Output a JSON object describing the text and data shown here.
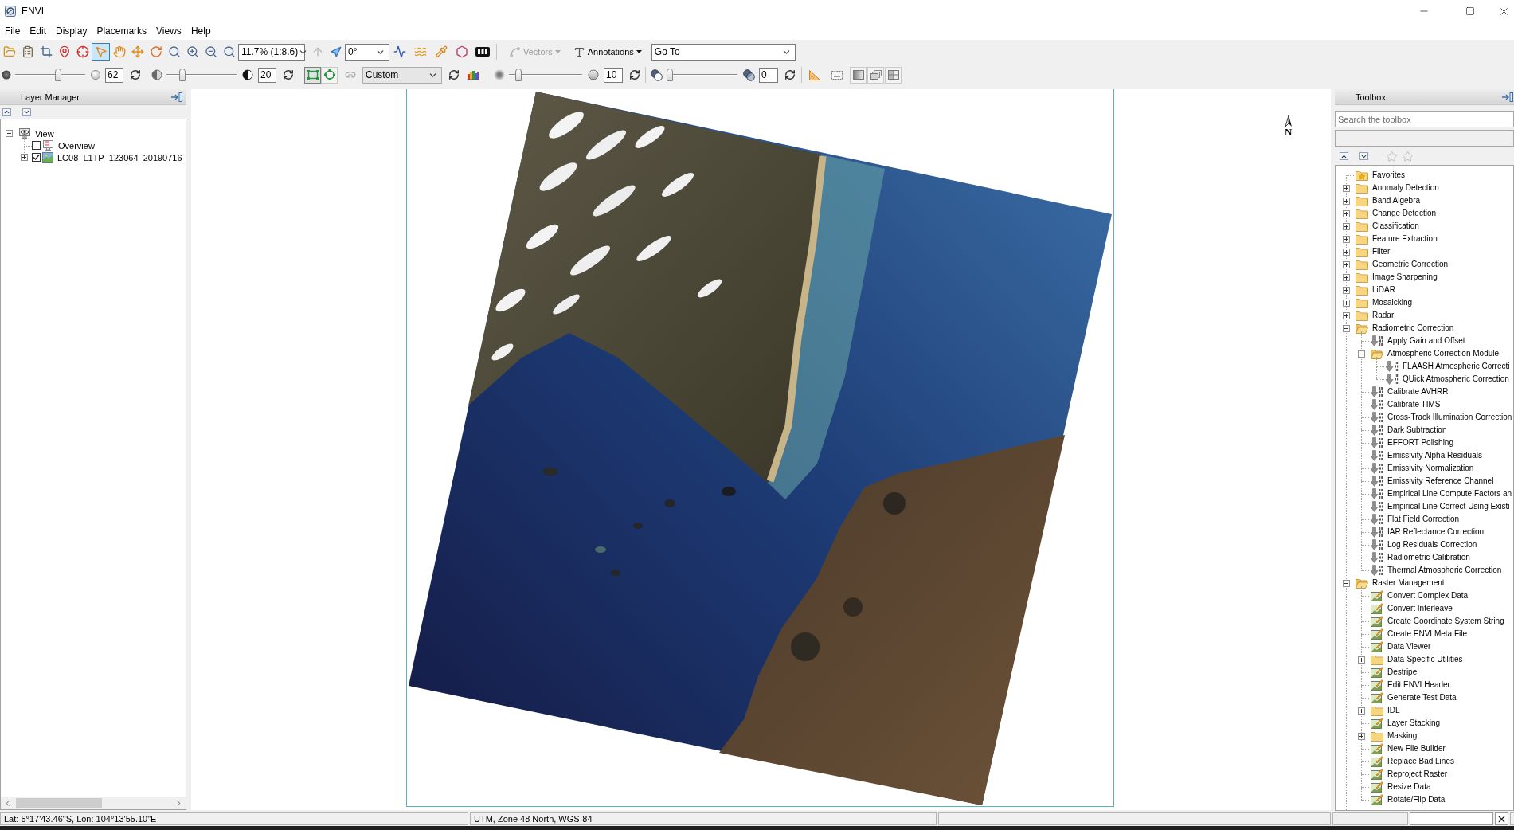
{
  "window": {
    "title": "ENVI"
  },
  "menu_bar": [
    "File",
    "Edit",
    "Display",
    "Placemarks",
    "Views",
    "Help"
  ],
  "toolbar": {
    "mode_tools": [
      {
        "kind": "cursor",
        "selected": true
      },
      {
        "kind": "pan",
        "selected": false
      },
      {
        "kind": "fly",
        "selected": false
      },
      {
        "kind": "rotate",
        "selected": false
      },
      {
        "kind": "zoom",
        "selected": false
      }
    ],
    "zoom_level": "11.7% (1:8.6)",
    "rotation": "0°",
    "vectors_menu": {
      "label": "Vectors",
      "disabled": true
    },
    "annotations_menu": {
      "label": "Annotations",
      "disabled": false
    },
    "go_to": "Go To"
  },
  "display_toolbar": {
    "brightness": {
      "level": 0.62,
      "value": "62"
    },
    "contrast": {
      "level": 0.2,
      "value": "20"
    },
    "extent_tools": [
      {
        "kind": "square",
        "selected": true
      },
      {
        "kind": "round",
        "selected": false
      }
    ],
    "stretch": "Custom",
    "sharpen": {
      "level": 0.1,
      "value": "10"
    },
    "transparency": {
      "level": 0,
      "value": "0"
    }
  },
  "layer_manager": {
    "title": "Layer Manager",
    "tree": [
      {
        "label": "View",
        "kind": "view",
        "expanded": true,
        "children": [
          {
            "label": "Overview",
            "kind": "overview",
            "checked": false
          },
          {
            "label": "LC08_L1TP_123064_20190716",
            "kind": "raster",
            "checked": true,
            "expanded": false
          }
        ]
      }
    ]
  },
  "view": {
    "north_arrow": "N"
  },
  "toolbox": {
    "title": "Toolbox",
    "search": {
      "placeholder": "Search the toolbox"
    },
    "tree": [
      {
        "label": "Favorites",
        "kind": "favorites"
      },
      {
        "label": "Anomaly Detection",
        "kind": "folder",
        "expanded": false
      },
      {
        "label": "Band Algebra",
        "kind": "folder",
        "expanded": false
      },
      {
        "label": "Change Detection",
        "kind": "folder",
        "expanded": false
      },
      {
        "label": "Classification",
        "kind": "folder",
        "expanded": false
      },
      {
        "label": "Feature Extraction",
        "kind": "folder",
        "expanded": false
      },
      {
        "label": "Filter",
        "kind": "folder",
        "expanded": false
      },
      {
        "label": "Geometric Correction",
        "kind": "folder",
        "expanded": false
      },
      {
        "label": "Image Sharpening",
        "kind": "folder",
        "expanded": false
      },
      {
        "label": "LiDAR",
        "kind": "folder",
        "expanded": false
      },
      {
        "label": "Mosaicking",
        "kind": "folder",
        "expanded": false
      },
      {
        "label": "Radar",
        "kind": "folder",
        "expanded": false
      },
      {
        "label": "Radiometric Correction",
        "kind": "folder",
        "expanded": true,
        "children": [
          {
            "label": "Apply Gain and Offset",
            "kind": "tool"
          },
          {
            "label": "Atmospheric Correction Module",
            "kind": "folder",
            "expanded": true,
            "children": [
              {
                "label": "FLAASH Atmospheric Correcti",
                "kind": "tool"
              },
              {
                "label": "QUick Atmospheric Correction",
                "kind": "tool"
              }
            ]
          },
          {
            "label": "Calibrate AVHRR",
            "kind": "tool"
          },
          {
            "label": "Calibrate TIMS",
            "kind": "tool"
          },
          {
            "label": "Cross-Track Illumination Correction",
            "kind": "tool"
          },
          {
            "label": "Dark Subtraction",
            "kind": "tool"
          },
          {
            "label": "EFFORT Polishing",
            "kind": "tool"
          },
          {
            "label": "Emissivity Alpha Residuals",
            "kind": "tool"
          },
          {
            "label": "Emissivity Normalization",
            "kind": "tool"
          },
          {
            "label": "Emissivity Reference Channel",
            "kind": "tool"
          },
          {
            "label": "Empirical Line Compute Factors an",
            "kind": "tool"
          },
          {
            "label": "Empirical Line Correct Using Existi",
            "kind": "tool"
          },
          {
            "label": "Flat Field Correction",
            "kind": "tool"
          },
          {
            "label": "IAR Reflectance Correction",
            "kind": "tool"
          },
          {
            "label": "Log Residuals Correction",
            "kind": "tool"
          },
          {
            "label": "Radiometric Calibration",
            "kind": "tool"
          },
          {
            "label": "Thermal Atmospheric Correction",
            "kind": "tool"
          }
        ]
      },
      {
        "label": "Raster Management",
        "kind": "folder",
        "expanded": true,
        "children": [
          {
            "label": "Convert Complex Data",
            "kind": "utility"
          },
          {
            "label": "Convert Interleave",
            "kind": "utility"
          },
          {
            "label": "Create Coordinate System String",
            "kind": "utility"
          },
          {
            "label": "Create ENVI Meta File",
            "kind": "utility"
          },
          {
            "label": "Data Viewer",
            "kind": "utility"
          },
          {
            "label": "Data-Specific Utilities",
            "kind": "folder",
            "expanded": false
          },
          {
            "label": "Destripe",
            "kind": "utility"
          },
          {
            "label": "Edit ENVI Header",
            "kind": "utility"
          },
          {
            "label": "Generate Test Data",
            "kind": "utility"
          },
          {
            "label": "IDL",
            "kind": "folder",
            "expanded": false
          },
          {
            "label": "Layer Stacking",
            "kind": "utility"
          },
          {
            "label": "Masking",
            "kind": "folder",
            "expanded": false
          },
          {
            "label": "New File Builder",
            "kind": "utility"
          },
          {
            "label": "Replace Bad Lines",
            "kind": "utility"
          },
          {
            "label": "Reproject Raster",
            "kind": "utility"
          },
          {
            "label": "Resize Data",
            "kind": "utility"
          },
          {
            "label": "Rotate/Flip Data",
            "kind": "utility"
          }
        ]
      }
    ]
  },
  "status_bar": [
    "Lat: 5°17'43.46\"S, Lon: 104°13'55.10\"E",
    "UTM, Zone 48 North, WGS-84"
  ]
}
